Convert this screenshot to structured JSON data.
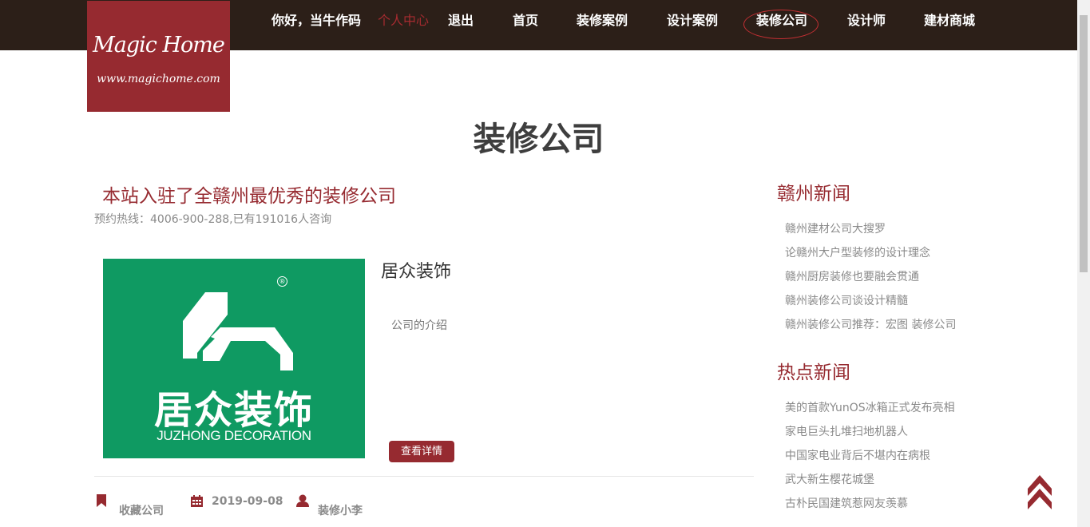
{
  "header": {
    "logo_line1": "Magic Home",
    "logo_line2": "www.magichome.com",
    "greeting": "你好，当牛作码",
    "user_center": "个人中心",
    "logout": "退出",
    "nav": [
      "首页",
      "装修案例",
      "设计案例",
      "装修公司",
      "设计师",
      "建材商城"
    ],
    "active_nav": "装修公司"
  },
  "page": {
    "title": "装修公司"
  },
  "intro": {
    "title": "本站入驻了全赣州最优秀的装修公司",
    "subtitle": "预约热线：4006-900-288,已有191016人咨询"
  },
  "company": {
    "name": "居众装饰",
    "description": "公司的介绍",
    "logo_text_cn": "居众装饰",
    "logo_text_en": "JUZHONG DECORATION",
    "logo_registered": "®",
    "detail_button": "查看详情",
    "favorite": "收藏公司",
    "date": "2019-09-08",
    "author": "装修小李"
  },
  "sidebar": {
    "ganzhou_news_title": "赣州新闻",
    "ganzhou_news": [
      "赣州建材公司大搜罗",
      "论赣州大户型装修的设计理念",
      "赣州厨房装修也要融会贯通",
      "赣州装修公司谈设计精髓",
      "赣州装修公司推荐：宏图 装修公司"
    ],
    "hot_news_title": "热点新闻",
    "hot_news": [
      "美的首款YunOS冰箱正式发布亮相",
      "家电巨头扎堆扫地机器人",
      "中国家电业背后不堪内在病根",
      "武大新生樱花城堡",
      "古朴民国建筑惹网友羡慕"
    ]
  },
  "colors": {
    "brand": "#962a30",
    "topbar": "#2c1f18",
    "company_logo_bg": "#0f9a62"
  },
  "icons": {
    "favorite": "bookmark-icon",
    "date": "calendar-icon",
    "author": "user-icon",
    "back_to_top": "double-chevron-up-icon"
  }
}
